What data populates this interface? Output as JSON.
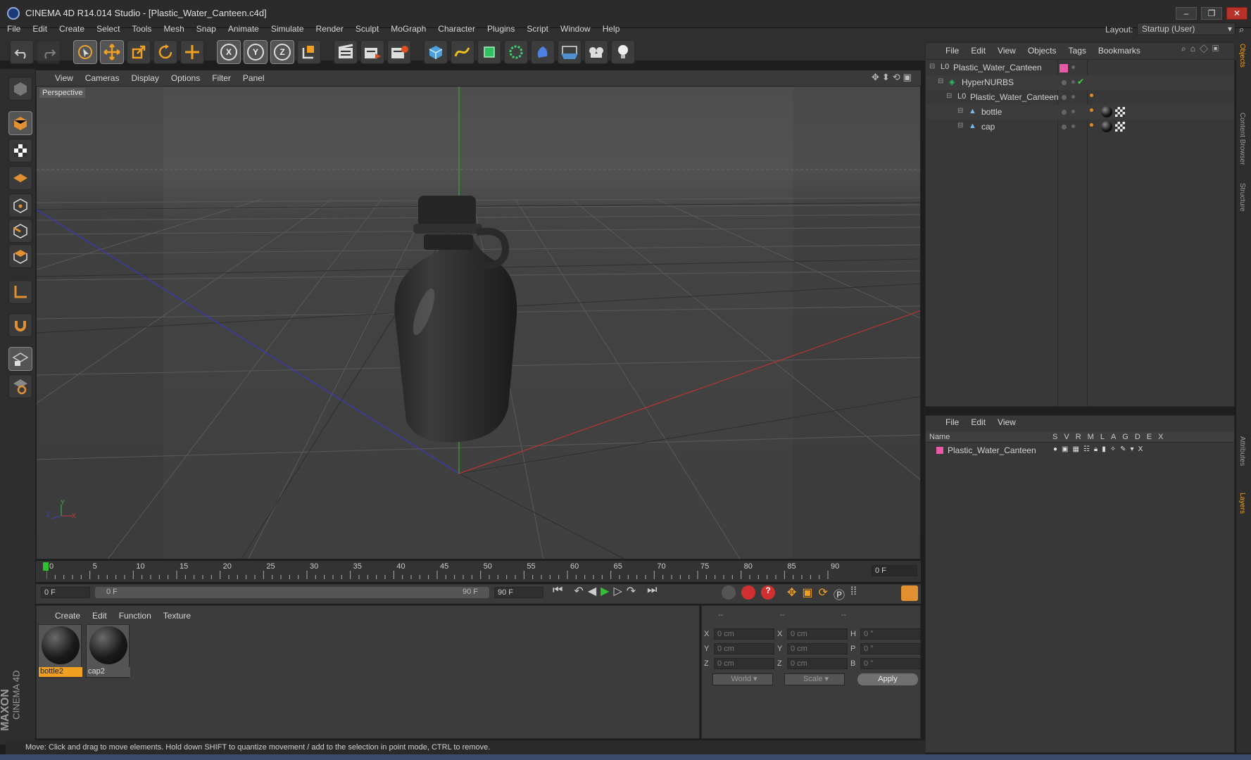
{
  "window": {
    "title": "CINEMA 4D R14.014 Studio - [Plastic_Water_Canteen.c4d]"
  },
  "menu": [
    "File",
    "Edit",
    "Create",
    "Select",
    "Tools",
    "Mesh",
    "Snap",
    "Animate",
    "Simulate",
    "Render",
    "Sculpt",
    "MoGraph",
    "Character",
    "Plugins",
    "Script",
    "Window",
    "Help"
  ],
  "layout": {
    "label": "Layout:",
    "value": "Startup (User)"
  },
  "toolbar": {
    "axis_x": "X",
    "axis_y": "Y",
    "axis_z": "Z"
  },
  "viewport": {
    "menu": [
      "View",
      "Cameras",
      "Display",
      "Options",
      "Filter",
      "Panel"
    ],
    "label": "Perspective",
    "axis_y": "Y",
    "axis_x": "X",
    "axis_z": "Z"
  },
  "timeline": {
    "ticks": [
      "0",
      "5",
      "10",
      "15",
      "20",
      "25",
      "30",
      "35",
      "40",
      "45",
      "50",
      "55",
      "60",
      "65",
      "70",
      "75",
      "80",
      "85",
      "90"
    ],
    "current_frame": "0 F",
    "start_frame": "0 F",
    "range_start": "0 F",
    "range_end": "90 F",
    "end_frame": "90 F"
  },
  "material_panel": {
    "menu": [
      "Create",
      "Edit",
      "Function",
      "Texture"
    ],
    "materials": [
      {
        "name": "bottle2",
        "selected": true
      },
      {
        "name": "cap2",
        "selected": false
      }
    ]
  },
  "coords": {
    "header": [
      "--",
      "--",
      "--"
    ],
    "rows": [
      {
        "a": "X",
        "pos": "0 cm",
        "b": "X",
        "size": "0 cm",
        "c": "H",
        "rot": "0 °"
      },
      {
        "a": "Y",
        "pos": "0 cm",
        "b": "Y",
        "size": "0 cm",
        "c": "P",
        "rot": "0 °"
      },
      {
        "a": "Z",
        "pos": "0 cm",
        "b": "Z",
        "size": "0 cm",
        "c": "B",
        "rot": "0 °"
      }
    ],
    "mode1": "World",
    "mode2": "Scale",
    "apply": "Apply"
  },
  "objects": {
    "menu": [
      "File",
      "Edit",
      "View",
      "Objects",
      "Tags",
      "Bookmarks"
    ],
    "items": [
      "Plastic_Water_Canteen",
      "HyperNURBS",
      "Plastic_Water_Canteen",
      "bottle",
      "cap"
    ]
  },
  "layers": {
    "menu": [
      "File",
      "Edit",
      "View"
    ],
    "name_header": "Name",
    "columns": [
      "S",
      "V",
      "R",
      "M",
      "L",
      "A",
      "G",
      "D",
      "E",
      "X"
    ],
    "row": "Plastic_Water_Canteen"
  },
  "side_tabs": [
    "Objects",
    "Content Browser",
    "Structure",
    "Attributes",
    "Layers"
  ],
  "brand": {
    "maxon": "MAXON",
    "cinema": "CINEMA 4D"
  },
  "status": "Move: Click and drag to move elements. Hold down SHIFT to quantize movement / add to the selection in point mode, CTRL to remove.",
  "colors": {
    "accent": "#f0a020",
    "layer_pink": "#e85aa8",
    "play_green": "#34c034",
    "record_red": "#d03030"
  }
}
